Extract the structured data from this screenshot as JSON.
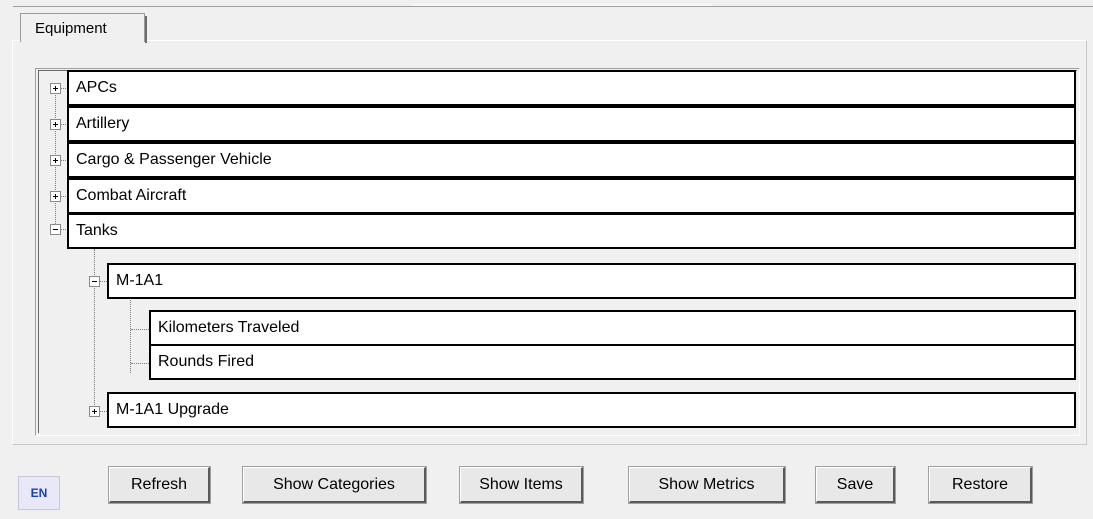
{
  "tabs": [
    {
      "label": "Equipment"
    }
  ],
  "tree": {
    "categories": [
      {
        "label": "APCs",
        "expanded": false
      },
      {
        "label": "Artillery",
        "expanded": false
      },
      {
        "label": "Cargo & Passenger Vehicle",
        "expanded": false
      },
      {
        "label": "Combat Aircraft",
        "expanded": false
      },
      {
        "label": "Tanks",
        "expanded": true,
        "items": [
          {
            "label": "M-1A1",
            "expanded": true,
            "metrics": [
              {
                "label": "Kilometers Traveled"
              },
              {
                "label": "Rounds Fired"
              }
            ]
          },
          {
            "label": "M-1A1 Upgrade",
            "expanded": false
          }
        ]
      }
    ]
  },
  "language": {
    "code": "EN"
  },
  "buttons": {
    "refresh": "Refresh",
    "show_categories": "Show Categories",
    "show_items": "Show Items",
    "show_metrics": "Show Metrics",
    "save": "Save",
    "restore": "Restore"
  }
}
